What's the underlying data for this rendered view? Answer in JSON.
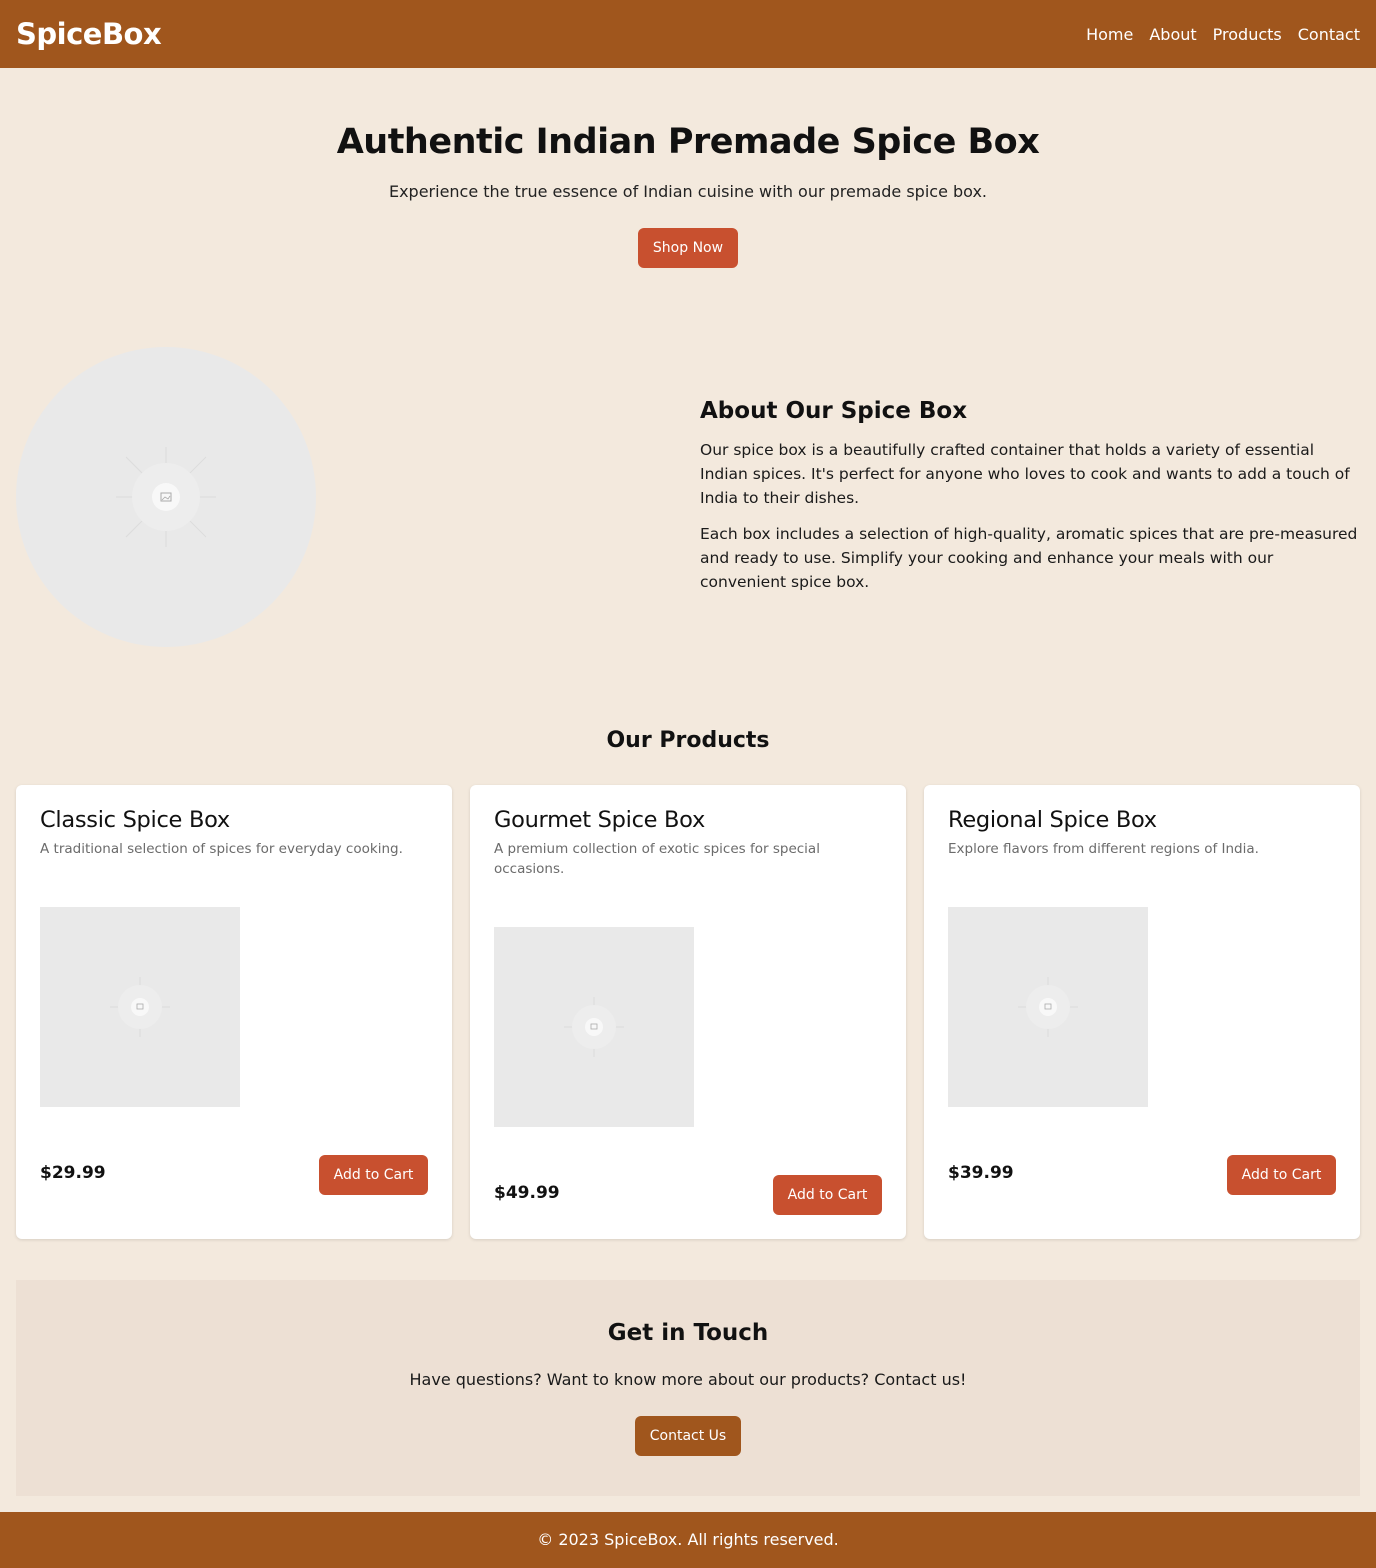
{
  "header": {
    "brand": "SpiceBox",
    "nav": [
      "Home",
      "About",
      "Products",
      "Contact"
    ]
  },
  "hero": {
    "title": "Authentic Indian Premade Spice Box",
    "subtitle": "Experience the true essence of Indian cuisine with our premade spice box.",
    "cta": "Shop Now"
  },
  "about": {
    "image_icon": "image-placeholder-icon",
    "title": "About Our Spice Box",
    "paragraphs": [
      "Our spice box is a beautifully crafted container that holds a variety of essential Indian spices. It's perfect for anyone who loves to cook and wants to add a touch of India to their dishes.",
      "Each box includes a selection of high-quality, aromatic spices that are pre-measured and ready to use. Simplify your cooking and enhance your meals with our convenient spice box."
    ]
  },
  "products": {
    "title": "Our Products",
    "items": [
      {
        "name": "Classic Spice Box",
        "description": "A traditional selection of spices for everyday cooking.",
        "price": "$29.99",
        "button": "Add to Cart"
      },
      {
        "name": "Gourmet Spice Box",
        "description": "A premium collection of exotic spices for special occasions.",
        "price": "$49.99",
        "button": "Add to Cart"
      },
      {
        "name": "Regional Spice Box",
        "description": "Explore flavors from different regions of India.",
        "price": "$39.99",
        "button": "Add to Cart"
      }
    ]
  },
  "contact": {
    "title": "Get in Touch",
    "text": "Have questions? Want to know more about our products? Contact us!",
    "button": "Contact Us"
  },
  "footer": {
    "text": "© 2023 SpiceBox. All rights reserved."
  },
  "colors": {
    "brand": "#a0561d",
    "accent": "#c8502f",
    "background": "#f3e9dd"
  }
}
